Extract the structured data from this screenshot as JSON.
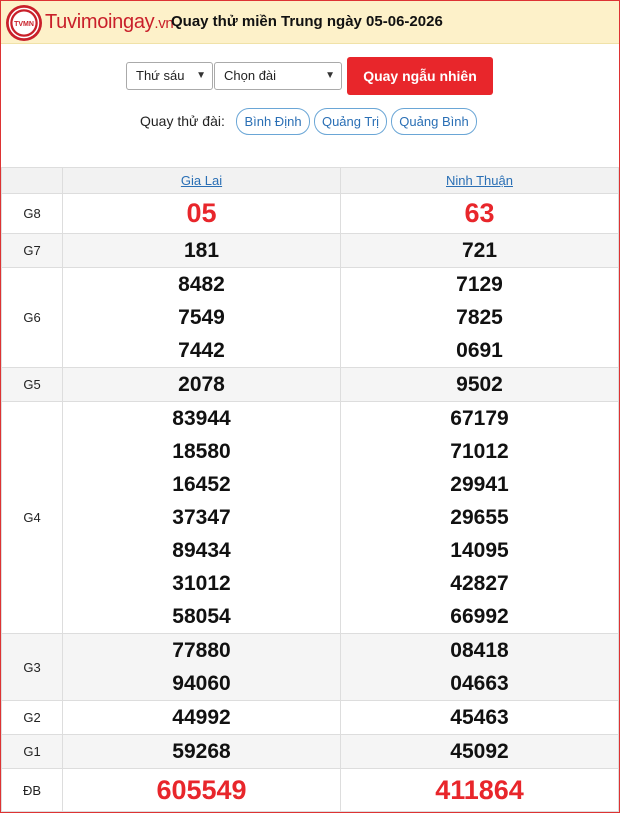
{
  "brand": {
    "name": "Tuvimoingay",
    "tld": ".vn",
    "logo_text": "TVMN"
  },
  "page_title": "Quay thử miền Trung ngày 05-06-2026",
  "controls": {
    "day_select": "Thứ sáu",
    "province_select": "Chọn đài",
    "random_button": "Quay ngẫu nhiên"
  },
  "province_filter": {
    "label": "Quay thử đài:",
    "chips": [
      "Bình Định",
      "Quảng Trị",
      "Quảng Bình"
    ]
  },
  "table": {
    "columns": [
      "Gia Lai",
      "Ninh Thuận"
    ],
    "rows": [
      {
        "prize": "G8",
        "col1": [
          "05"
        ],
        "col2": [
          "63"
        ]
      },
      {
        "prize": "G7",
        "col1": [
          "181"
        ],
        "col2": [
          "721"
        ]
      },
      {
        "prize": "G6",
        "col1": [
          "8482",
          "7549",
          "7442"
        ],
        "col2": [
          "7129",
          "7825",
          "0691"
        ]
      },
      {
        "prize": "G5",
        "col1": [
          "2078"
        ],
        "col2": [
          "9502"
        ]
      },
      {
        "prize": "G4",
        "col1": [
          "83944",
          "18580",
          "16452",
          "37347",
          "89434",
          "31012",
          "58054"
        ],
        "col2": [
          "67179",
          "71012",
          "29941",
          "29655",
          "14095",
          "42827",
          "66992"
        ]
      },
      {
        "prize": "G3",
        "col1": [
          "77880",
          "94060"
        ],
        "col2": [
          "08418",
          "04663"
        ]
      },
      {
        "prize": "G2",
        "col1": [
          "44992"
        ],
        "col2": [
          "45463"
        ]
      },
      {
        "prize": "G1",
        "col1": [
          "59268"
        ],
        "col2": [
          "45092"
        ]
      },
      {
        "prize": "ĐB",
        "col1": [
          "605549"
        ],
        "col2": [
          "411864"
        ]
      }
    ]
  },
  "colors": {
    "accent_red": "#e8262b",
    "link_blue": "#2a6fb5",
    "header_bg": "#fdf1c9"
  }
}
